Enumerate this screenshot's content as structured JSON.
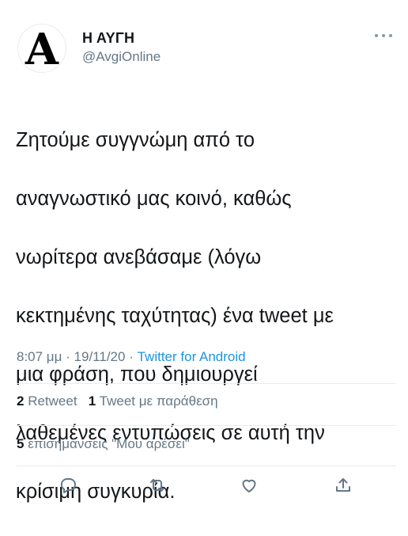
{
  "author": {
    "avatar_letter": "A",
    "display_name": "Η ΑΥΓΗ",
    "handle": "@AvgiOnline"
  },
  "tweet": {
    "text_lines": [
      "Ζητούμε συγγνώμη από το",
      "αναγνωστικό μας κοινό, καθώς",
      "νωρίτερα ανεβάσαμε (λόγω",
      "κεκτημένης ταχύτητας) ένα tweet με",
      "μια φράση, που δημιουργεί",
      "λαθεμένες εντυπώσεις σε αυτή την",
      "κρίσιμη συγκυρία."
    ],
    "time": "8:07 μμ",
    "separator": "·",
    "date": "19/11/20",
    "source": "Twitter for Android"
  },
  "stats": {
    "retweets_count": "2",
    "retweets_label": "Retweet",
    "quotes_count": "1",
    "quotes_label": "Tweet με παράθεση",
    "likes_count": "5",
    "likes_label": "επισημάνσεις \"Μου αρέσει\""
  },
  "actions": {
    "reply_icon": "reply-icon",
    "retweet_icon": "retweet-icon",
    "like_icon": "heart-icon",
    "share_icon": "share-icon"
  },
  "colors": {
    "text": "#14171a",
    "secondary": "#657786",
    "link": "#1b95e0",
    "divider": "#e6ecf0"
  }
}
